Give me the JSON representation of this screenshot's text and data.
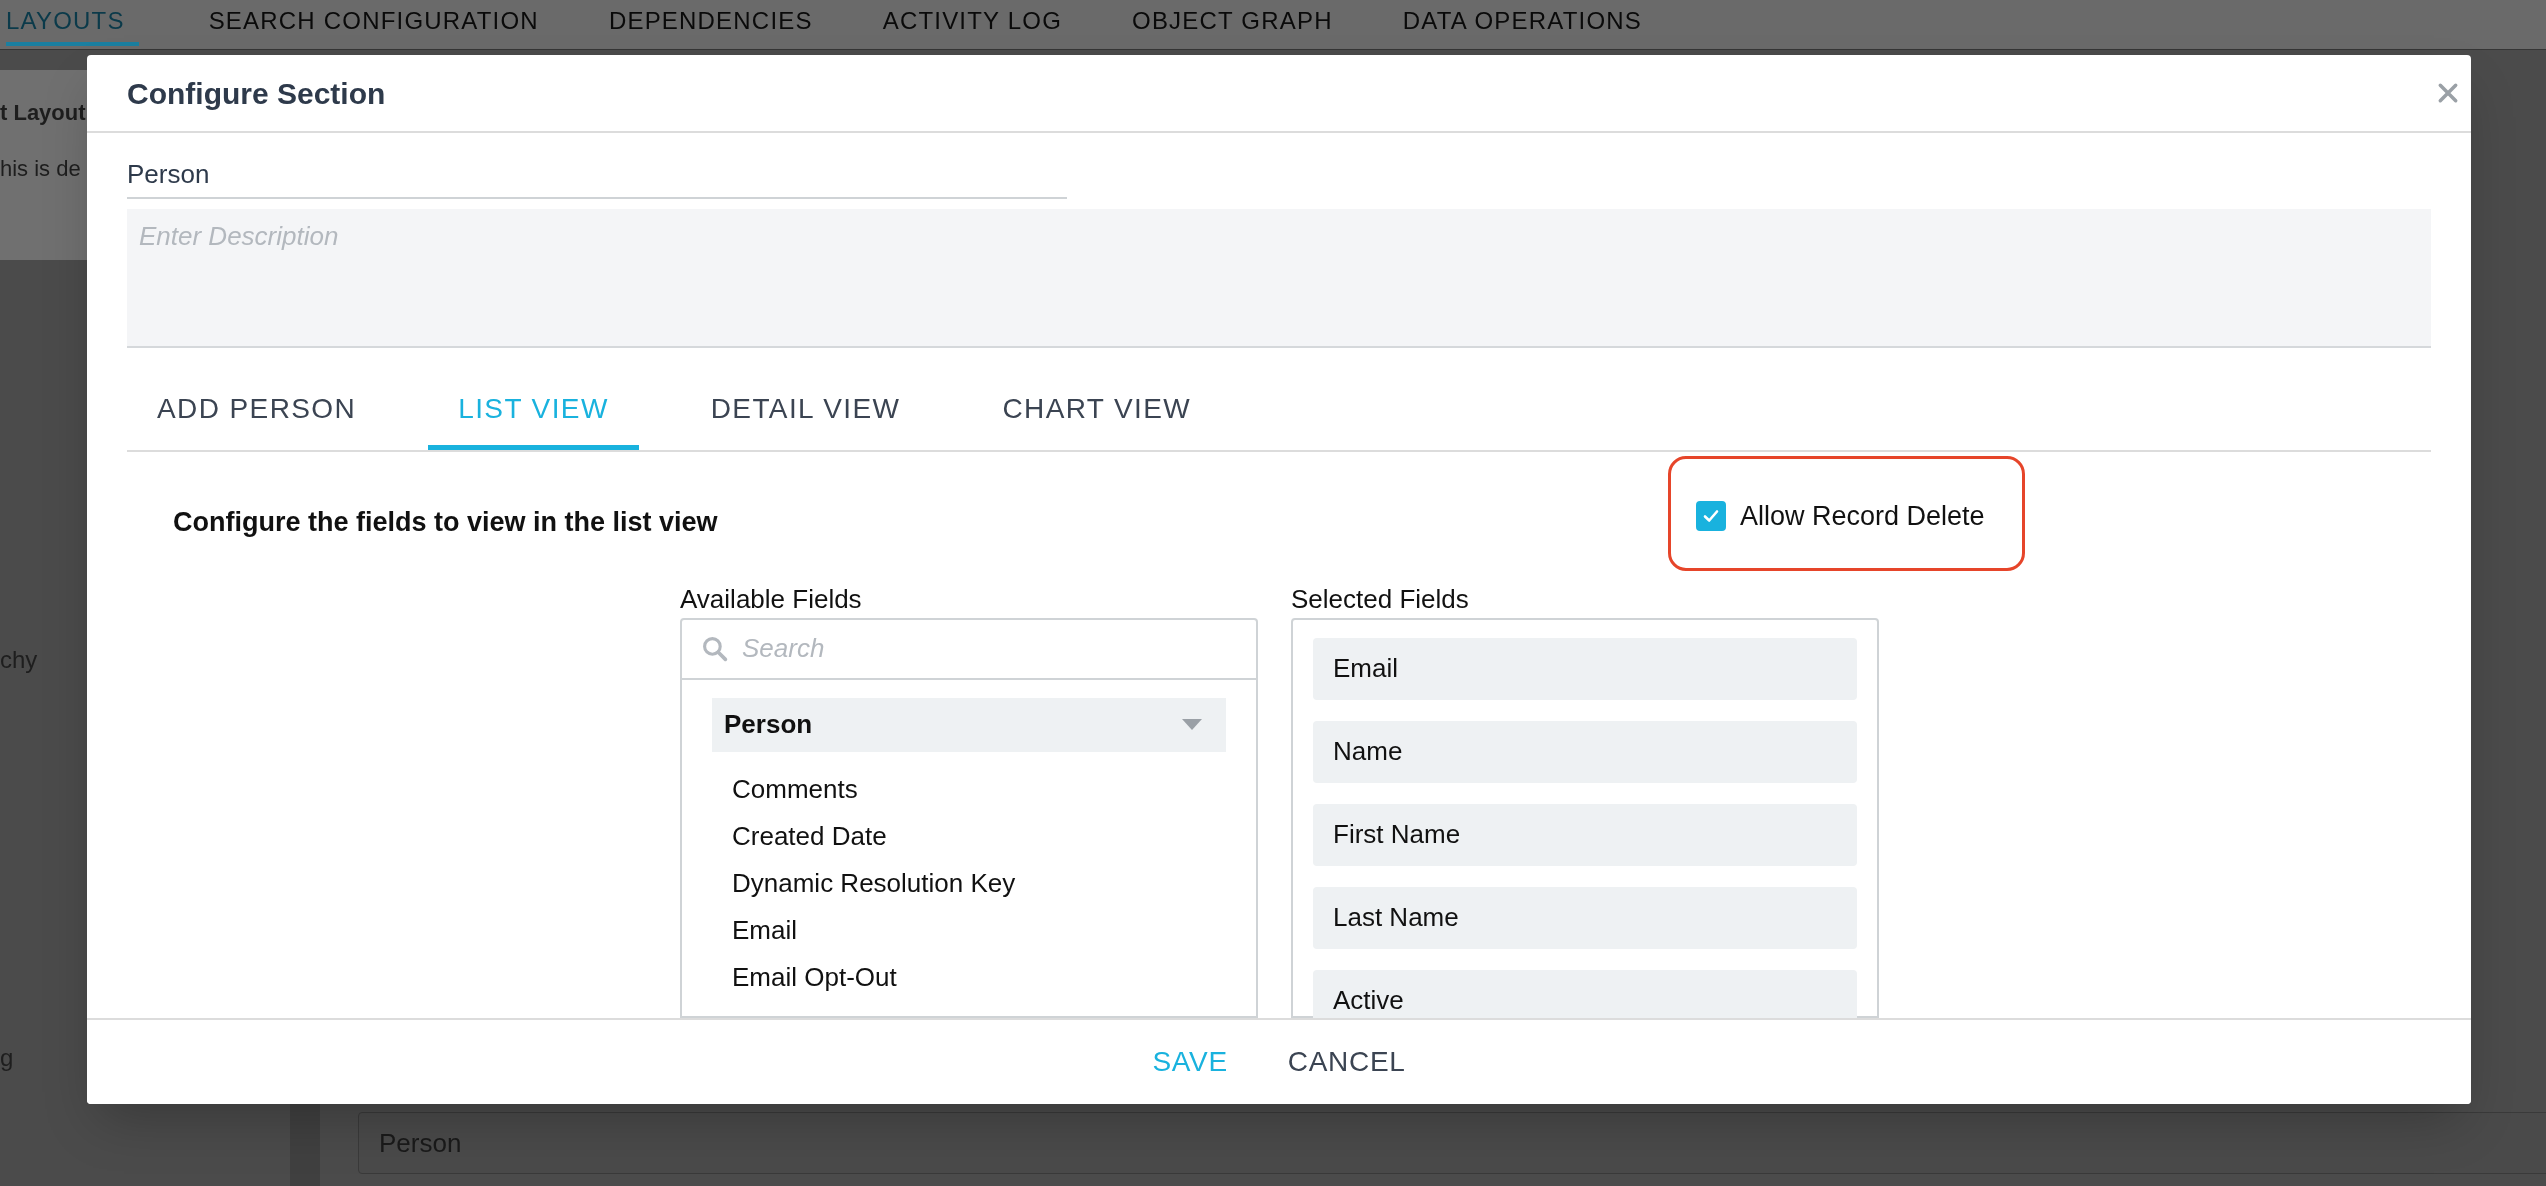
{
  "background": {
    "tabs": [
      {
        "label": "LAYOUTS",
        "selected": true
      },
      {
        "label": "SEARCH CONFIGURATION",
        "selected": false
      },
      {
        "label": "DEPENDENCIES",
        "selected": false
      },
      {
        "label": "ACTIVITY LOG",
        "selected": false
      },
      {
        "label": "OBJECT GRAPH",
        "selected": false
      },
      {
        "label": "DATA OPERATIONS",
        "selected": false
      }
    ],
    "left_texts": [
      "t Layout",
      "his is de",
      "chy",
      "g"
    ],
    "bottom_field": "Person"
  },
  "dialog": {
    "title": "Configure Section",
    "name": "Person",
    "description_placeholder": "Enter Description",
    "tabs": [
      {
        "label": "ADD PERSON",
        "selected": false
      },
      {
        "label": "LIST VIEW",
        "selected": true
      },
      {
        "label": "DETAIL VIEW",
        "selected": false
      },
      {
        "label": "CHART VIEW",
        "selected": false
      }
    ],
    "heading": "Configure the fields to view in the list view",
    "allow_record_delete": {
      "label": "Allow Record Delete",
      "checked": true
    },
    "available": {
      "label": "Available Fields",
      "search_placeholder": "Search",
      "group": "Person",
      "items": [
        "Comments",
        "Created Date",
        "Dynamic Resolution Key",
        "Email",
        "Email Opt-Out"
      ]
    },
    "selected": {
      "label": "Selected Fields",
      "items": [
        "Email",
        "Name",
        "First Name",
        "Last Name",
        "Active"
      ]
    },
    "buttons": [
      {
        "label": "SAVE",
        "kind": "primary"
      },
      {
        "label": "CANCEL",
        "kind": "secondary"
      }
    ]
  }
}
